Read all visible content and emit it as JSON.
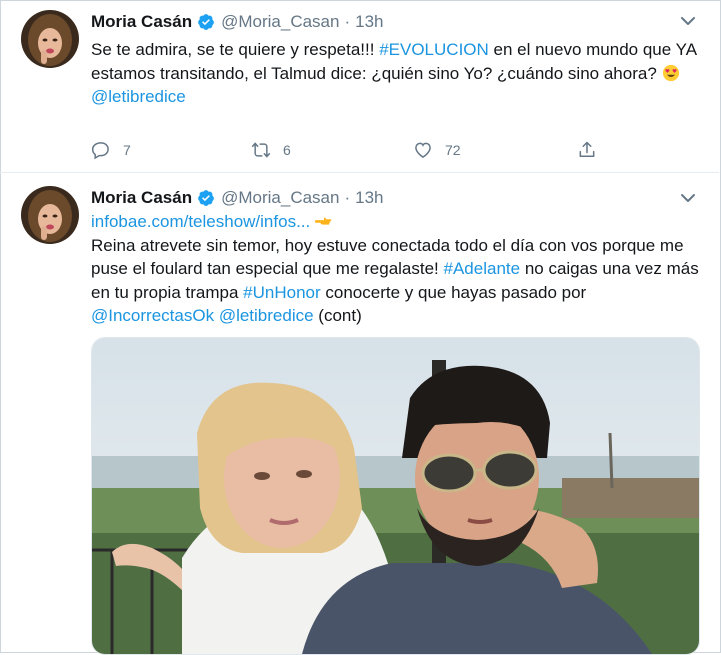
{
  "tweets": [
    {
      "author_name": "Moria Casán",
      "handle": "@Moria_Casan",
      "separator": "·",
      "time": "13h",
      "text_1": "Se te admira, se te quiere y respeta!!! ",
      "hashtag_1": "#EVOLUCION",
      "text_2": " en el nuevo mundo que YA estamos transitando, el Talmud dice: ¿quién sino Yo? ¿cuándo sino ahora? ",
      "mention_1": "@letibredice",
      "reply_count": "7",
      "retweet_count": "6",
      "like_count": "72"
    },
    {
      "author_name": "Moria Casán",
      "handle": "@Moria_Casan",
      "separator": "·",
      "time": "13h",
      "url": "infobae.com/teleshow/infos...",
      "text_1": "Reina atrevete sin temor, hoy estuve conectada todo el día con vos porque me puse el foulard tan especial que me regalaste! ",
      "hashtag_1": "#Adelante",
      "text_2": " no caigas una vez más en tu propia trampa ",
      "hashtag_2": "#UnHonor",
      "text_3": " conocerte y que hayas pasado por ",
      "mention_1": "@IncorrectasOk",
      "mention_2": "@letibredice",
      "text_4": " (cont)"
    }
  ],
  "icons": {
    "verified": "verified-badge-icon",
    "caret": "chevron-down-icon",
    "reply": "reply-icon",
    "retweet": "retweet-icon",
    "like": "heart-icon",
    "share": "share-icon",
    "heart_eyes": "heart-eyes-emoji",
    "pointing": "backhand-pointing-left-emoji"
  },
  "colors": {
    "link": "#1b95e0",
    "muted": "#657786",
    "verified": "#1da1f2",
    "text": "#14171a"
  }
}
